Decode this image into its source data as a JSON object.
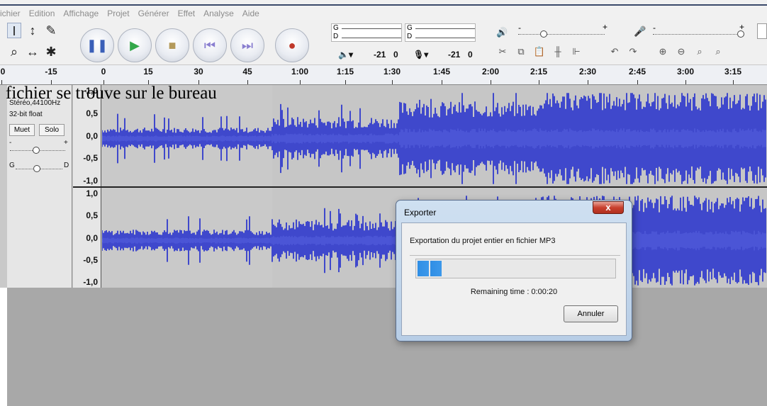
{
  "menu": {
    "items": [
      "ichier",
      "Edition",
      "Affichage",
      "Projet",
      "Générer",
      "Effet",
      "Analyse",
      "Aide"
    ]
  },
  "toolbar": {
    "tools": [
      "I",
      "↕",
      "✎",
      "⌕",
      "↔",
      "✱"
    ],
    "transport": [
      {
        "name": "pause-button",
        "icon": "pause-icon",
        "glyph": "❚❚",
        "color": "#3a5fb8"
      },
      {
        "name": "play-button",
        "icon": "play-icon",
        "glyph": "▶",
        "color": "#34a84a"
      },
      {
        "name": "stop-button",
        "icon": "stop-icon",
        "glyph": "■",
        "color": "#b49a5a"
      },
      {
        "name": "skip-start-button",
        "icon": "skip-start-icon",
        "glyph": "⏮",
        "color": "#8a7fd0"
      },
      {
        "name": "skip-end-button",
        "icon": "skip-end-icon",
        "glyph": "⏭",
        "color": "#8a7fd0"
      },
      {
        "name": "record-button",
        "icon": "record-icon",
        "glyph": "●",
        "color": "#c0392b"
      }
    ],
    "meter_play": {
      "g": "G",
      "d": "D",
      "value": "-21",
      "zero": "0"
    },
    "meter_rec": {
      "g": "G",
      "d": "D",
      "value": "-21",
      "zero": "0"
    },
    "mixer_play_plus": "+",
    "mixer_play_minus": "-",
    "mixer_rec_plus": "+",
    "mixer_rec_minus": "-"
  },
  "ruler": {
    "ticks": [
      "0",
      "-15",
      "0",
      "15",
      "30",
      "45",
      "1:00",
      "1:15",
      "1:30",
      "1:45",
      "2:00",
      "2:15",
      "2:30",
      "2:45",
      "3:00",
      "3:15"
    ]
  },
  "track": {
    "name": "",
    "format": "Stéréo,44100Hz",
    "bitdepth": "32-bit float",
    "mute": "Muet",
    "solo": "Solo",
    "gain_minus": "-",
    "gain_plus": "+",
    "pan_left": "G",
    "pan_right": "D",
    "scale_top": [
      "1,0",
      "0,5",
      "0,0",
      "-0,5",
      "-1,0"
    ],
    "scale_bottom": [
      "1,0",
      "0,5",
      "0,0",
      "-0,5",
      "-1,0"
    ],
    "wave_color": "#3f48cc",
    "selection_color": "#4b55d6"
  },
  "caption": "fichier se trouve sur le bureau",
  "dialog": {
    "title": "Exporter",
    "close_glyph": "x",
    "message": "Exportation du projet entier en fichier MP3",
    "progress": 0.13,
    "remaining": "Remaining time : 0:00:20",
    "cancel": "Annuler"
  }
}
